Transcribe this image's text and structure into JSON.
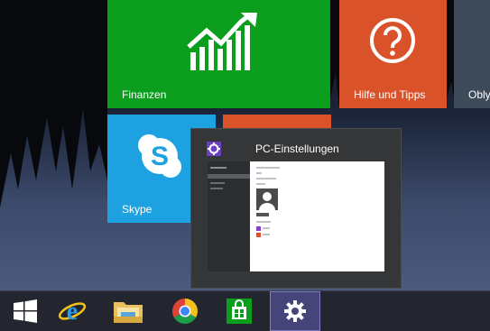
{
  "tiles": {
    "finanzen": {
      "label": "Finanzen",
      "color": "#0a9e1c"
    },
    "hilfe": {
      "label": "Hilfe und Tipps",
      "color": "#d9522a"
    },
    "obly": {
      "label": "Obly"
    },
    "skype": {
      "label": "Skype",
      "color": "#1ea1e1"
    }
  },
  "thumbnail": {
    "title": "PC-Einstellungen",
    "icon": "gear-icon"
  },
  "taskbar": {
    "items": [
      {
        "name": "start",
        "icon": "windows-logo-icon"
      },
      {
        "name": "internet-explorer",
        "icon": "internet-explorer-icon"
      },
      {
        "name": "file-explorer",
        "icon": "folder-icon"
      },
      {
        "name": "chrome",
        "icon": "chrome-icon"
      },
      {
        "name": "store",
        "icon": "store-icon"
      },
      {
        "name": "pc-settings",
        "icon": "gear-icon",
        "active": true
      }
    ]
  },
  "accent": "#6a3fc4"
}
